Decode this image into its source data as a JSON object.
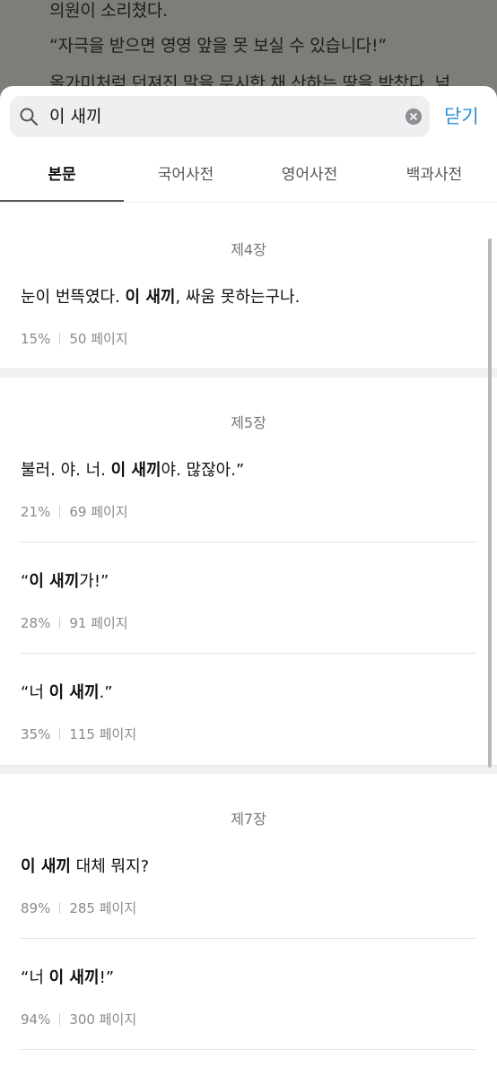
{
  "reader": {
    "line1": "의원이 소리쳤다.",
    "line2": "“자극을 받으면 영영 앞을 못 보실 수 있습니다!”",
    "line3": "올가미처럼 던져진 말을 무시한 채 산하는 땅을 박찼다. 넘"
  },
  "search": {
    "query": "이 새끼",
    "close_label": "닫기",
    "accent_color": "#2e8fd6"
  },
  "tabs": [
    {
      "label": "본문",
      "active": true
    },
    {
      "label": "국어사전",
      "active": false
    },
    {
      "label": "영어사전",
      "active": false
    },
    {
      "label": "백과사전",
      "active": false
    }
  ],
  "chapters": [
    {
      "title": "제4장",
      "results": [
        {
          "pre": "눈이 번뜩였다. ",
          "match": "이 새끼",
          "post": ", 싸움 못하는구나.",
          "percent": "15%",
          "page": "50 페이지"
        }
      ]
    },
    {
      "title": "제5장",
      "results": [
        {
          "pre": "불러. 야. 너. ",
          "match": "이 새끼",
          "post": "야. 많잖아.”",
          "percent": "21%",
          "page": "69 페이지"
        },
        {
          "pre": "“",
          "match": "이 새끼",
          "post": "가!”",
          "percent": "28%",
          "page": "91 페이지"
        },
        {
          "pre": "“너 ",
          "match": "이 새끼",
          "post": ".”",
          "percent": "35%",
          "page": "115 페이지"
        }
      ]
    },
    {
      "title": "제7장",
      "results": [
        {
          "pre": "",
          "match": "이 새끼",
          "post": " 대체 뭐지?",
          "percent": "89%",
          "page": "285 페이지"
        },
        {
          "pre": "“너 ",
          "match": "이 새끼",
          "post": "!”",
          "percent": "94%",
          "page": "300 페이지"
        }
      ]
    }
  ]
}
